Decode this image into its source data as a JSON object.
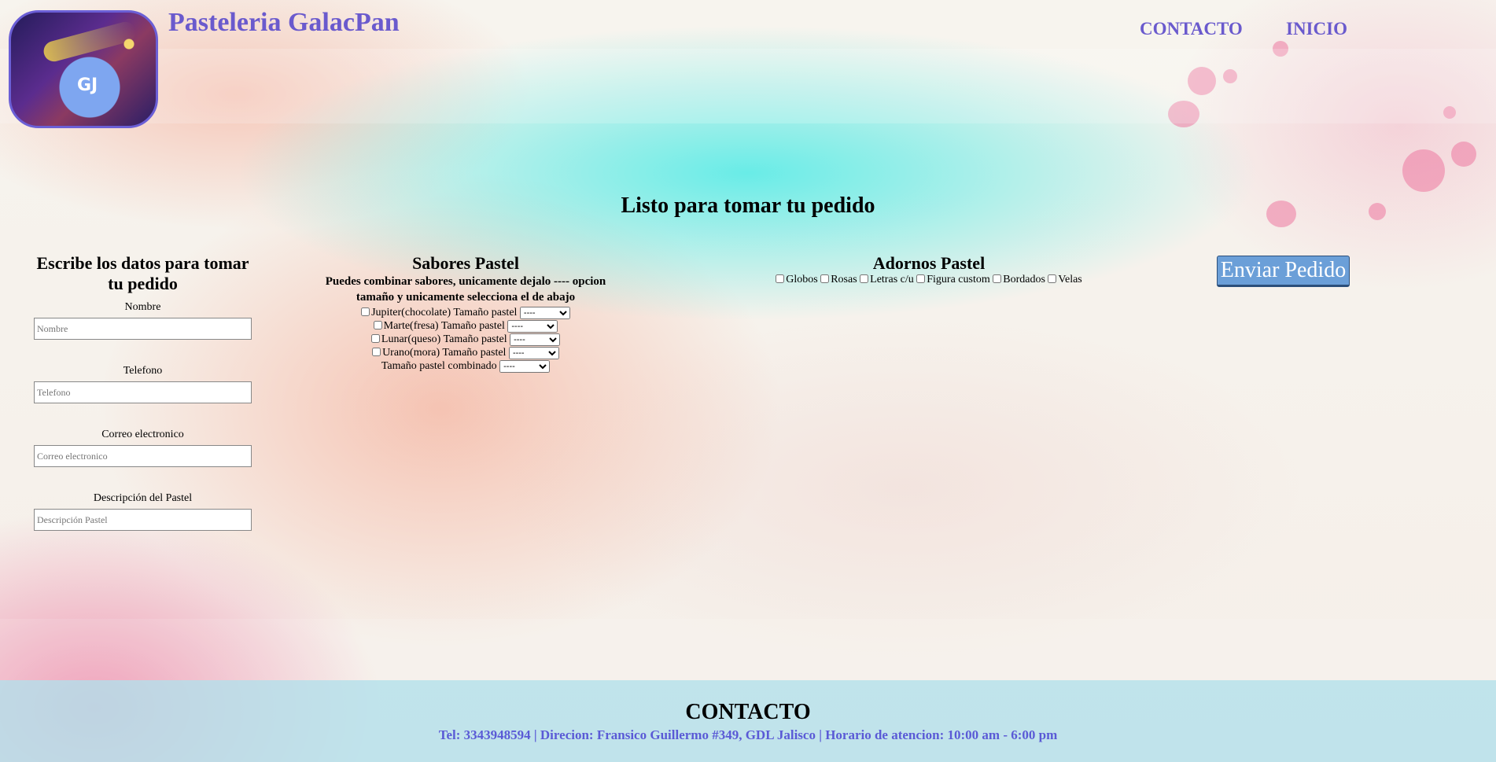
{
  "header": {
    "title": "Pasteleria GalacPan",
    "nav": [
      "CONTACTO",
      "INICIO"
    ]
  },
  "main": {
    "heading": "Listo para tomar tu pedido"
  },
  "form": {
    "heading": "Escribe los datos para tomar tu pedido",
    "fields": [
      {
        "label": "Nombre",
        "placeholder": "Nombre"
      },
      {
        "label": "Telefono",
        "placeholder": "Telefono"
      },
      {
        "label": "Correo electronico",
        "placeholder": "Correo electronico"
      },
      {
        "label": "Descripción del Pastel",
        "placeholder": "Descripción Pastel"
      }
    ]
  },
  "flavors": {
    "heading": "Sabores Pastel",
    "note": "Puedes combinar sabores, unicamente dejalo ---- opcion tamaño y unicamente selecciona el de abajo",
    "size_label": "Tamaño pastel",
    "items": [
      "Jupiter(chocolate)",
      "Marte(fresa)",
      "Lunar(queso)",
      "Urano(mora)"
    ],
    "combined_label": "Tamaño pastel combinado",
    "select_value": "----"
  },
  "decorations": {
    "heading": "Adornos Pastel",
    "items": [
      "Globos",
      "Rosas",
      "Letras c/u",
      "Figura custom",
      "Bordados",
      "Velas"
    ]
  },
  "submit_label": "Enviar Pedido",
  "footer": {
    "heading": "CONTACTO",
    "info": "Tel: 3343948594 | Direcion: Fransico Guillermo #349, GDL Jalisco | Horario de atencion: 10:00 am - 6:00 pm"
  },
  "colors": {
    "accent": "#6a5acd",
    "button": "#6b9fd8",
    "footer_bg": "#b4e1eb"
  }
}
